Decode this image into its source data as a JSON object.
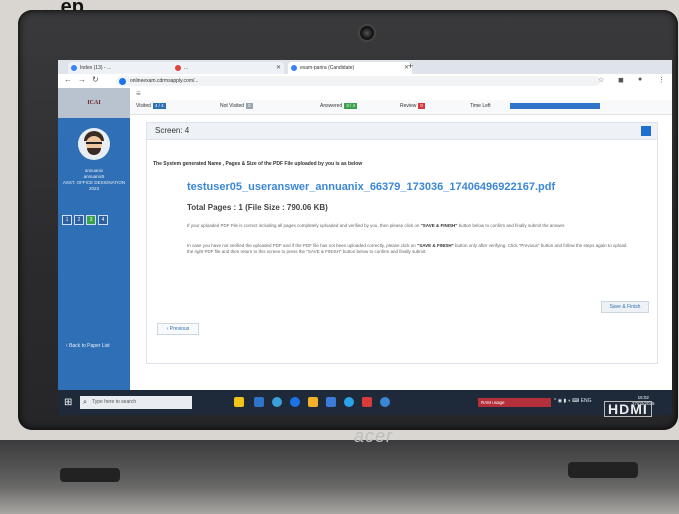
{
  "photo_caption": "...ep",
  "browser": {
    "tabs": [
      {
        "label": "Index (13) - ...",
        "active": false
      },
      {
        "label": "...",
        "active": false
      },
      {
        "label": "exam-parira (Candidate)",
        "active": true
      }
    ],
    "url": "onlineexam.cdrmsapply.com/..."
  },
  "app": {
    "sidebar": {
      "logo": "ICAI",
      "user_lines": [
        "annuanix",
        "annuanix5"
      ],
      "designation": "ASST. OFFICE DESIGNATION",
      "year": "2023",
      "question_buttons": [
        {
          "label": "1",
          "state": "default"
        },
        {
          "label": "2",
          "state": "default"
        },
        {
          "label": "3",
          "state": "answered"
        },
        {
          "label": "4",
          "state": "default"
        }
      ],
      "back_link": "Back to Paper List"
    },
    "status": {
      "visited_label": "Visited",
      "visited_value": "4 / 4",
      "not_visited_label": "Not Visited",
      "not_visited_value": "0",
      "answered_label": "Answered",
      "answered_value": "3 / 4",
      "review_label": "Review",
      "review_value": "0",
      "time_left_label": "Time Left"
    },
    "screen_title": "Screen: 4",
    "intro": "The System generated Name , Pages & Size of the PDF File uploaded by you is as below",
    "pdf_name": "testuser05_useranswer_annuanix_66379_173036_17406496922167.pdf",
    "pages_prefix": "Total Pages : 1 (File Size : ",
    "file_size": "790.06 KB",
    "pages_suffix": ")",
    "para1": "If your uploaded PDF File is correct including all pages completely uploaded and verified by you, then please click on",
    "para1_strong": "\"SAVE & FINISH\"",
    "para1_end": "button below to confirm and finally submit the answer.",
    "para2": "In case you have not verified the uploaded PDF and if the PDF file has not been uploaded correctly, please click on",
    "para2_strong": "\"SAVE & FINISH\"",
    "para2_end": "button only after verifying. Click \"Previous\" button and follow the steps again to upload the right PDF file and then return to this screen to press the \"SAVE & FINISH\" button below to confirm and finally submit.",
    "previous_btn": "Previous",
    "save_finish_btn": "Save & Finish"
  },
  "taskbar": {
    "search_placeholder": "Type here to search",
    "tray_alert": "RAM usage",
    "time": "15:02",
    "date": "27/02/2025"
  },
  "laptop": {
    "brand": "acer",
    "port_label": "HDMI"
  }
}
